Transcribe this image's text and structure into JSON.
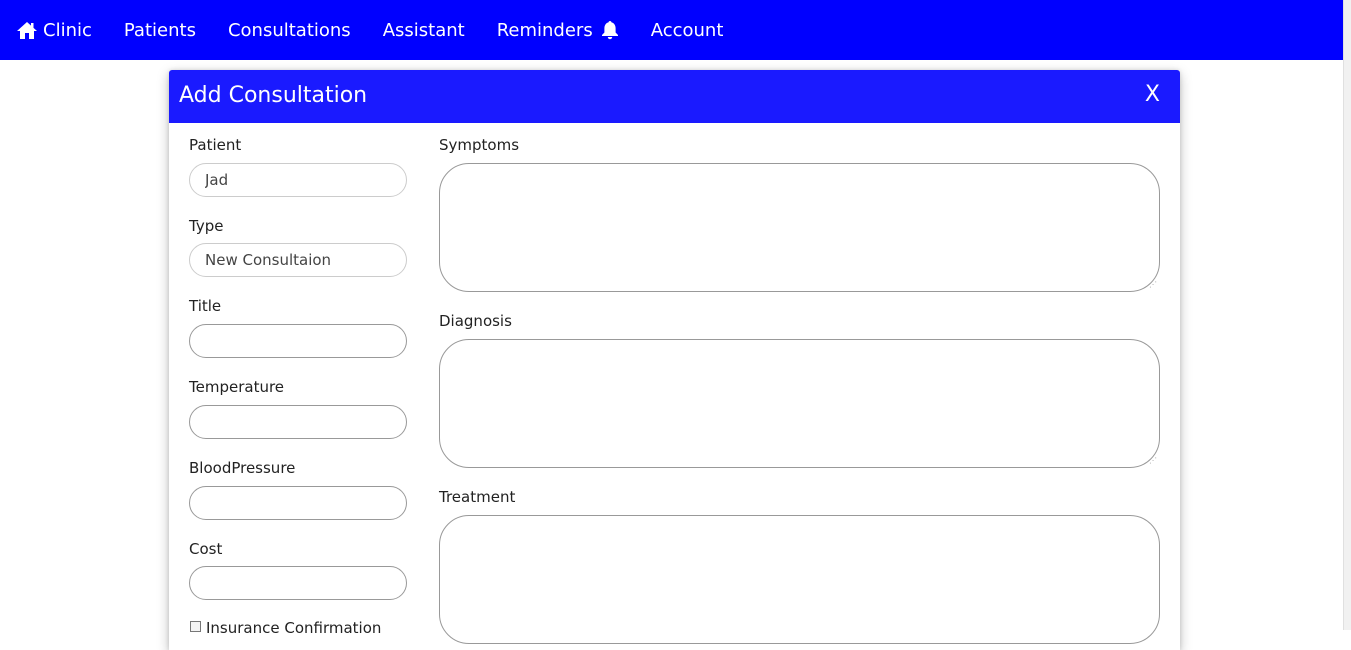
{
  "nav": {
    "brand": "Clinic",
    "items": [
      "Patients",
      "Consultations",
      "Assistant",
      "Reminders",
      "Account"
    ],
    "brand_icon": "home-icon",
    "reminders_icon": "bell-icon",
    "background": "#0000ff"
  },
  "modal": {
    "title": "Add Consultation",
    "close_label": "X",
    "header_color": "#1a1aff",
    "left_fields": {
      "patient": {
        "label": "Patient",
        "value": "Jad"
      },
      "type": {
        "label": "Type",
        "value": "New Consultaion"
      },
      "title": {
        "label": "Title",
        "value": ""
      },
      "temperature": {
        "label": "Temperature",
        "value": ""
      },
      "blood_pressure": {
        "label": "BloodPressure",
        "value": ""
      },
      "cost": {
        "label": "Cost",
        "value": ""
      }
    },
    "insurance": {
      "label": "Insurance Confirmation",
      "checked": false
    },
    "right_fields": {
      "symptoms": {
        "label": "Symptoms",
        "value": ""
      },
      "diagnosis": {
        "label": "Diagnosis",
        "value": ""
      },
      "treatment": {
        "label": "Treatment",
        "value": ""
      }
    }
  }
}
